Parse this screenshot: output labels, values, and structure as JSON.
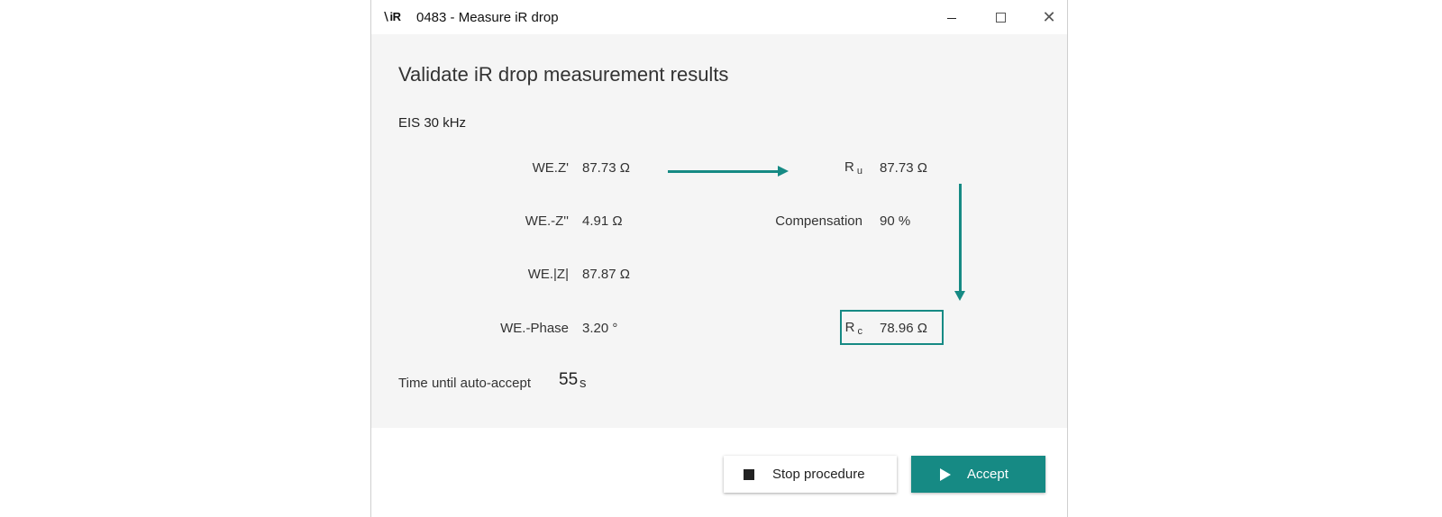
{
  "window": {
    "app_icon_text": "∖iR",
    "title": "0483 - Measure iR drop",
    "close_glyph": "✕"
  },
  "heading": "Validate iR drop measurement results",
  "section_label": "EIS 30 kHz",
  "measurements": [
    {
      "label": "WE.Z'",
      "value": "87.73 Ω"
    },
    {
      "label": "WE.-Z''",
      "value": "4.91 Ω"
    },
    {
      "label": "WE.|Z|",
      "value": "87.87 Ω"
    },
    {
      "label": "WE.-Phase",
      "value": "3.20 °"
    }
  ],
  "results": {
    "ru": {
      "label_main": "R",
      "label_sub": "u",
      "value": "87.73 Ω"
    },
    "compensation": {
      "label": "Compensation",
      "value": "90 %"
    },
    "rc": {
      "label_main": "R",
      "label_sub": "c",
      "value": "78.96 Ω"
    }
  },
  "countdown": {
    "label": "Time until auto-accept",
    "value": "55",
    "unit": "s"
  },
  "buttons": {
    "stop_label": "Stop procedure",
    "accept_label": "Accept"
  },
  "colors": {
    "accent": "#168a84",
    "content_bg": "#f5f5f5"
  }
}
